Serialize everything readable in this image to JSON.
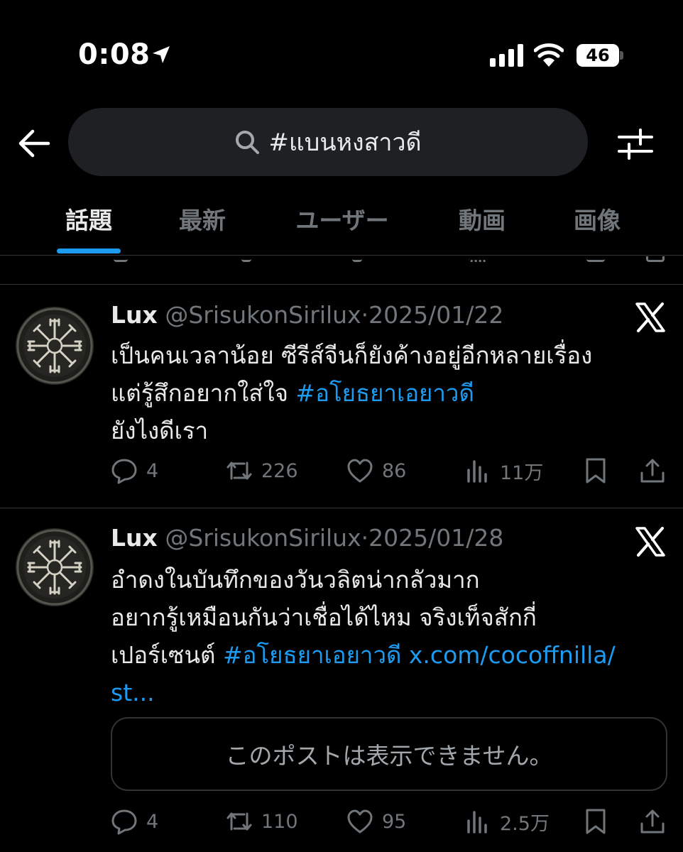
{
  "status_bar": {
    "time": "0:08",
    "battery": "46"
  },
  "search": {
    "query": "#แบนหงสาวดี"
  },
  "tabs": [
    {
      "label": "話題",
      "active": true
    },
    {
      "label": "最新",
      "active": false
    },
    {
      "label": "ユーザー",
      "active": false
    },
    {
      "label": "動画",
      "active": false
    },
    {
      "label": "画像",
      "active": false
    }
  ],
  "tweets": [
    {
      "name": "Lux",
      "handle": "@SrisukonSirilux",
      "separator": "·",
      "date": "2025/01/22",
      "text_line1": "เป็นคนเวลาน้อย ซีรีส์จีนก็ยังค้างอยู่อีกหลายเรื่อง",
      "text_line2_prefix": "แต่รู้สึกอยากใส่ใจ ",
      "hashtag": "#อโยธยาเอยาวดี",
      "text_line3": "ยังไงดีเรา",
      "replies": "4",
      "retweets": "226",
      "likes": "86",
      "views": "11万"
    },
    {
      "name": "Lux",
      "handle": "@SrisukonSirilux",
      "separator": "·",
      "date": "2025/01/28",
      "text_line1": "อำดงในบันทึกของวันวลิตน่ากลัวมาก",
      "text_line2": "อยากรู้เหมือนกันว่าเชื่อได้ไหม จริงเท็จสักกี่",
      "text_line3_prefix": "เปอร์เซนต์ ",
      "hashtag": "#อโยธยาเอยาวดี",
      "link_part1": "x.com/cocoffnilla/",
      "link_part2": "st...",
      "unavailable_text": "このポストは表示できません。",
      "replies": "4",
      "retweets": "110",
      "likes": "95",
      "views": "2.5万"
    }
  ],
  "colors": {
    "background": "#000000",
    "accent": "#1d9bf0",
    "secondary_text": "#71767b",
    "divider": "#2f3336"
  },
  "icons": [
    "location-arrow-icon",
    "cellular-signal-icon",
    "wifi-icon",
    "battery-icon",
    "back-arrow-icon",
    "search-icon",
    "filter-sliders-icon",
    "x-logo-icon",
    "reply-icon",
    "retweet-icon",
    "like-icon",
    "views-icon",
    "bookmark-icon",
    "share-icon"
  ]
}
